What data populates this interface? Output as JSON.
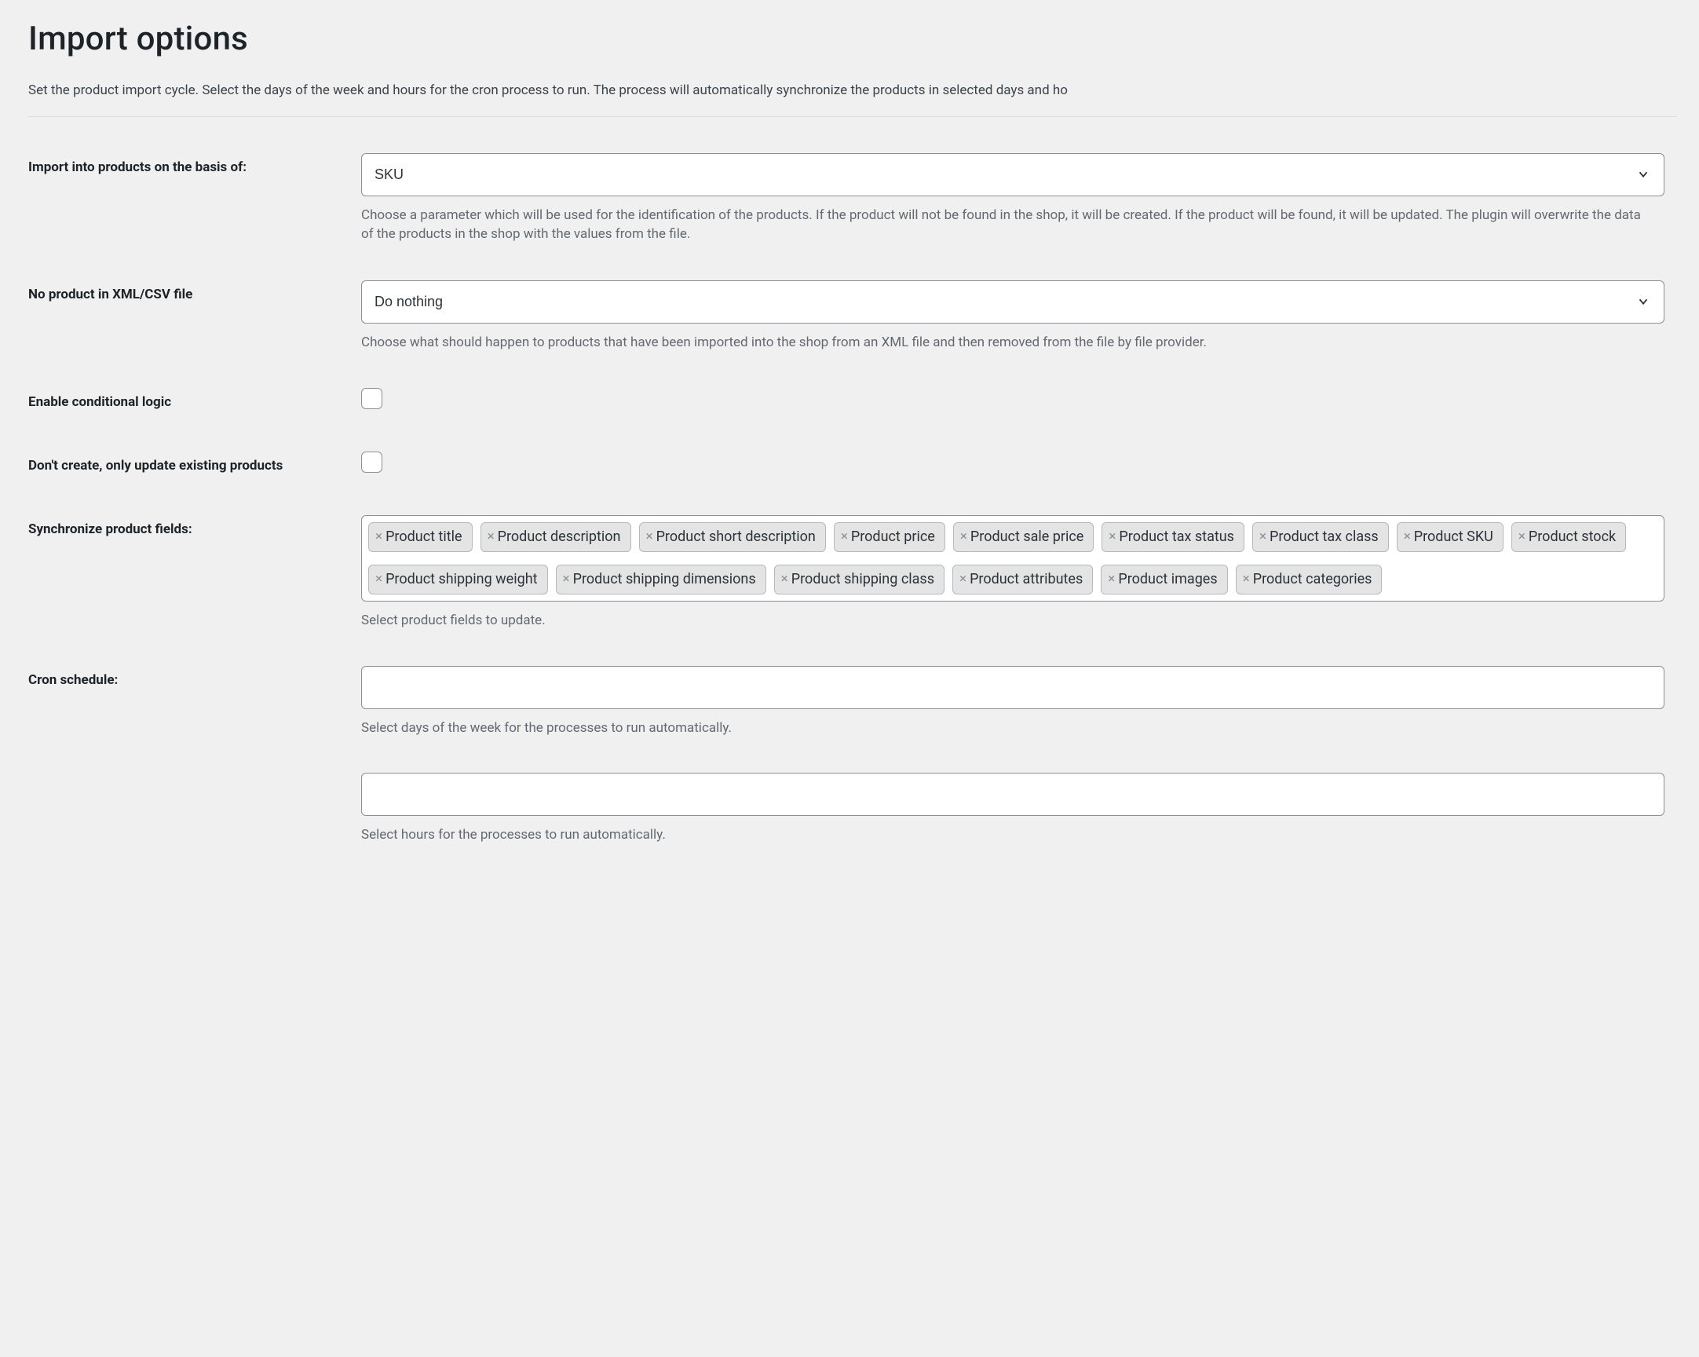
{
  "heading": "Import options",
  "intro": "Set the product import cycle. Select the days of the week and hours for the cron process to run. The process will automatically synchronize the products in selected days and ho",
  "rows": {
    "basis": {
      "label": "Import into products on the basis of:",
      "selected": "SKU",
      "help": "Choose a parameter which will be used for the identification of the products. If the product will not be found in the shop, it will be created. If the product will be found, it will be updated. The plugin will overwrite the data of the products in the shop with the values from the file."
    },
    "no_product": {
      "label": "No product in XML/CSV file",
      "selected": "Do nothing",
      "help": "Choose what should happen to products that have been imported into the shop from an XML file and then removed from the file by file provider."
    },
    "conditional": {
      "label": "Enable conditional logic"
    },
    "only_update": {
      "label": "Don't create, only update existing products"
    },
    "sync_fields": {
      "label": "Synchronize product fields:",
      "tags": [
        "Product title",
        "Product description",
        "Product short description",
        "Product price",
        "Product sale price",
        "Product tax status",
        "Product tax class",
        "Product SKU",
        "Product stock",
        "Product shipping weight",
        "Product shipping dimensions",
        "Product shipping class",
        "Product attributes",
        "Product images",
        "Product categories"
      ],
      "help": "Select product fields to update."
    },
    "cron": {
      "label": "Cron schedule:",
      "help_days": "Select days of the week for the processes to run automatically.",
      "help_hours": "Select hours for the processes to run automatically."
    }
  }
}
